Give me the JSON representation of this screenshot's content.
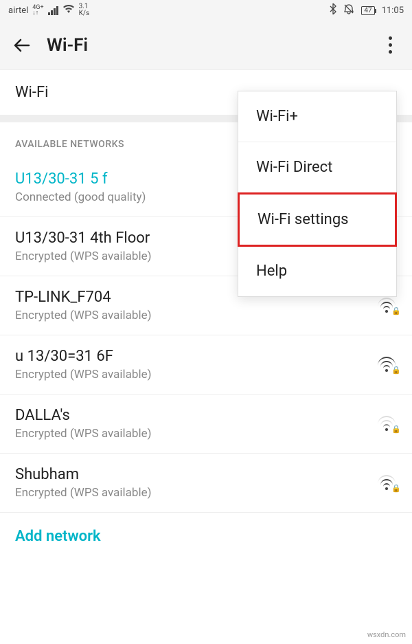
{
  "status_bar": {
    "carrier": "airtel",
    "net_top": "4G+",
    "net_bottom": "↓↑",
    "speed_top": "3.1",
    "speed_bottom": "K/s",
    "battery": "47",
    "time": "11:05"
  },
  "app_bar": {
    "title": "Wi-Fi"
  },
  "wifi_toggle": {
    "label": "Wi-Fi"
  },
  "section_header": "AVAILABLE NETWORKS",
  "networks": [
    {
      "name": "U13/30-31 5 f",
      "status": "Connected (good quality)",
      "connected": true
    },
    {
      "name": "U13/30-31 4th Floor",
      "status": "Encrypted (WPS available)",
      "connected": false
    },
    {
      "name": "TP-LINK_F704",
      "status": "Encrypted (WPS available)",
      "connected": false
    },
    {
      "name": "u 13/30=31 6F",
      "status": "Encrypted (WPS available)",
      "connected": false
    },
    {
      "name": "DALLA's",
      "status": "Encrypted (WPS available)",
      "connected": false
    },
    {
      "name": "Shubham",
      "status": "Encrypted (WPS available)",
      "connected": false
    }
  ],
  "add_network_label": "Add network",
  "popup": {
    "items": [
      {
        "label": "Wi-Fi+"
      },
      {
        "label": "Wi-Fi Direct"
      },
      {
        "label": "Wi-Fi settings"
      },
      {
        "label": "Help"
      }
    ]
  },
  "watermark": "wsxdn.com"
}
